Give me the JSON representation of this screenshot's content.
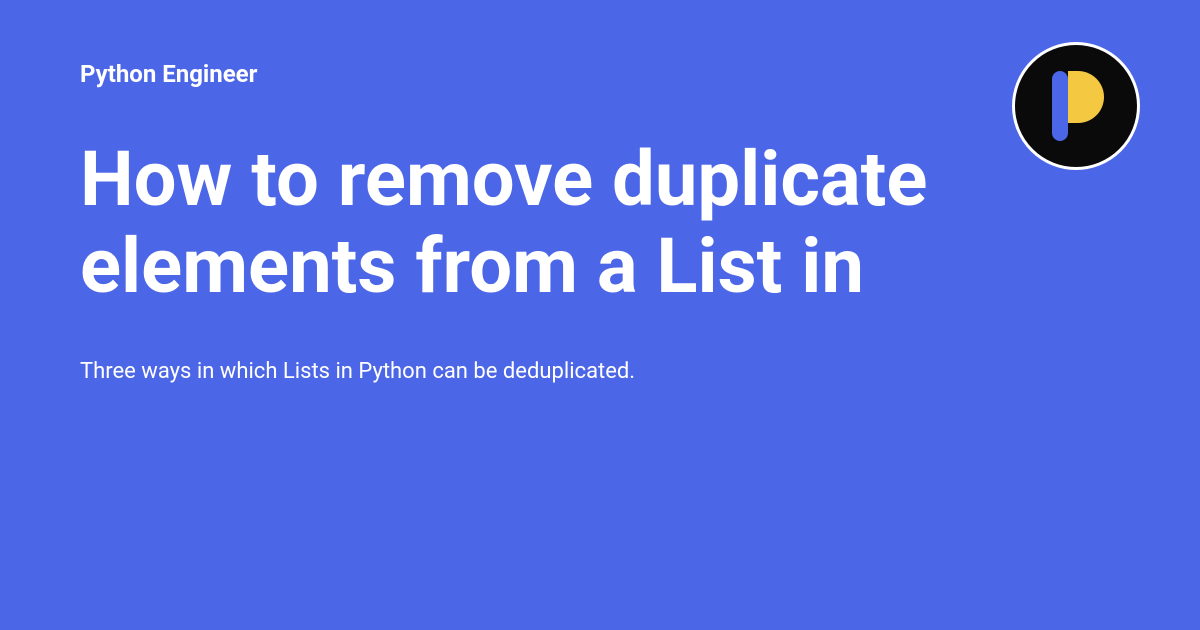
{
  "site": {
    "name": "Python Engineer"
  },
  "article": {
    "title": "How to remove duplicate elements from a List in",
    "subtitle": "Three ways in which Lists in Python can be deduplicated."
  },
  "colors": {
    "background": "#4C66E8",
    "text": "#ffffff",
    "logo_bg": "#0a0a0a",
    "logo_bar": "#4C66E8",
    "logo_arc": "#F5C842"
  }
}
